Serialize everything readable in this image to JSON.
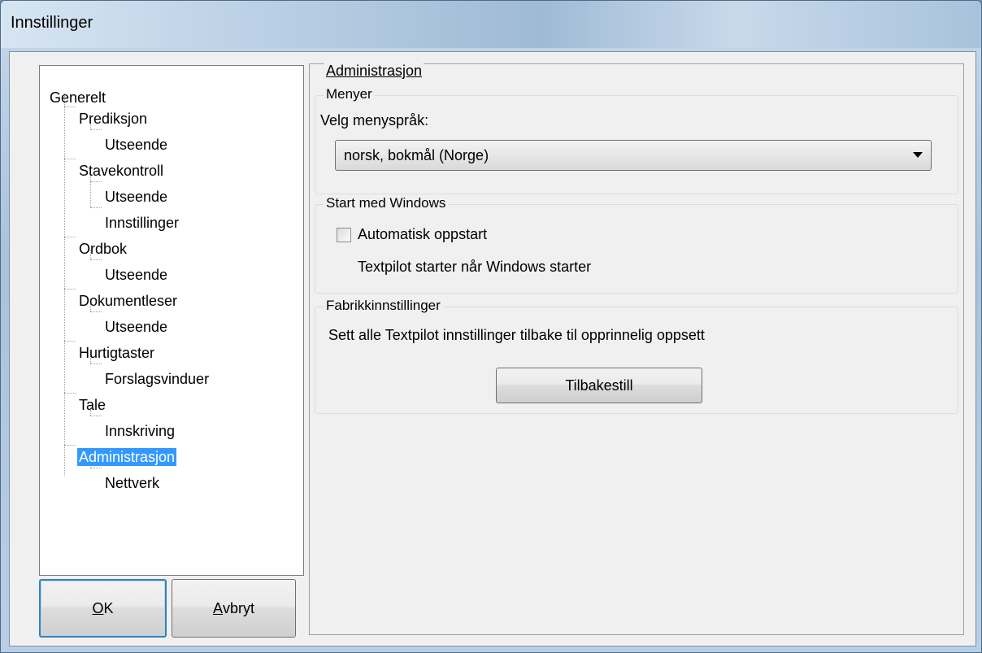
{
  "window": {
    "title": "Innstillinger"
  },
  "tree": {
    "items": [
      {
        "label": "Generelt"
      },
      {
        "label": "Prediksjon"
      },
      {
        "label": "Utseende"
      },
      {
        "label": "Stavekontroll"
      },
      {
        "label": "Utseende"
      },
      {
        "label": "Innstillinger"
      },
      {
        "label": "Ordbok"
      },
      {
        "label": "Utseende"
      },
      {
        "label": "Dokumentleser"
      },
      {
        "label": "Utseende"
      },
      {
        "label": "Hurtigtaster"
      },
      {
        "label": "Forslagsvinduer"
      },
      {
        "label": "Tale"
      },
      {
        "label": "Innskriving"
      },
      {
        "label": "Administrasjon"
      },
      {
        "label": "Nettverk"
      }
    ],
    "selected": "Administrasjon"
  },
  "buttons": {
    "ok_mnemonic": "O",
    "ok_rest": "K",
    "cancel_mnemonic": "A",
    "cancel_rest": "vbryt"
  },
  "panel": {
    "title": "Administrasjon",
    "menus": {
      "group_label": "Menyer",
      "prompt": "Velg menyspråk:",
      "selected_language": "norsk, bokmål (Norge)"
    },
    "startup": {
      "group_label": "Start med Windows",
      "checkbox_label": "Automatisk oppstart",
      "checked": false,
      "description": "Textpilot starter når Windows starter"
    },
    "factory": {
      "group_label": "Fabrikkinnstillinger",
      "description": "Sett alle Textpilot innstillinger tilbake til opprinnelig oppsett",
      "reset_label": "Tilbakestill"
    }
  },
  "colors": {
    "selection": "#3399ff",
    "default_button_border": "#3c7fb1"
  }
}
